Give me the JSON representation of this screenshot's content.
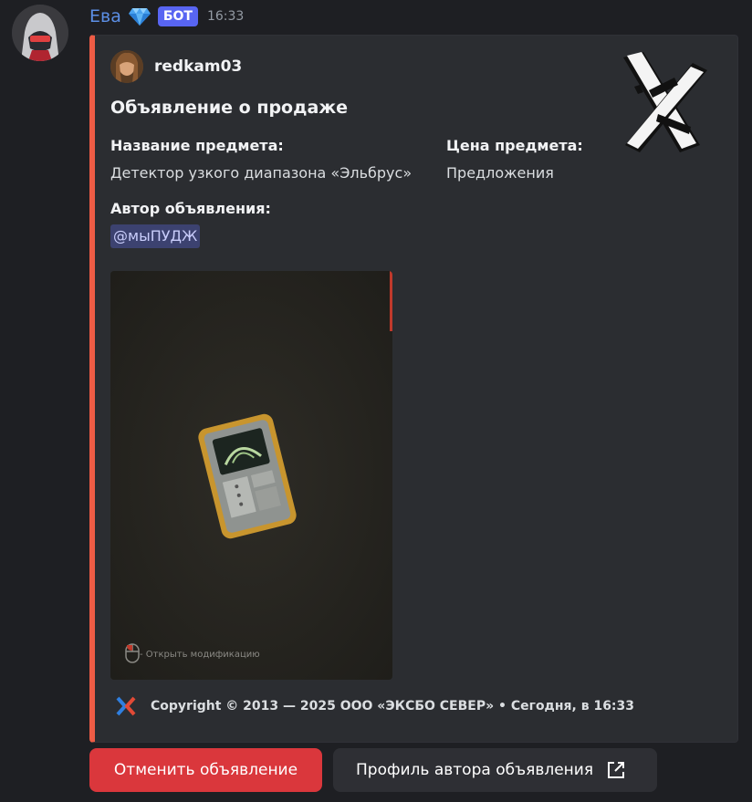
{
  "message": {
    "username": "Ева",
    "bot_badge": "БОТ",
    "timestamp": "16:33"
  },
  "embed": {
    "author_name": "redkam03",
    "title": "Объявление о продаже",
    "fields": {
      "item_name_label": "Название предмета:",
      "item_name_value": "Детектор узкого диапазона «Эльбрус»",
      "price_label": "Цена предмета:",
      "price_value": "Предложения",
      "author_label": "Автор объявления:",
      "author_mention": "@мыПУДЖ"
    },
    "image_hint": "- Открыть модификацию",
    "footer_text": "Copyright © 2013 — 2025 ООО «ЭКСБО СЕВЕР» • Сегодня, в 16:33",
    "accent_color": "#ee5c45"
  },
  "buttons": {
    "cancel_label": "Отменить объявление",
    "profile_label": "Профиль автора объявления"
  },
  "icons": {
    "avatar": "bot-avatar",
    "gem": "gem-icon",
    "thumbnail": "x-logo-icon",
    "footer": "exbo-logo-icon",
    "external": "external-link-icon",
    "mouse": "mouse-icon"
  }
}
